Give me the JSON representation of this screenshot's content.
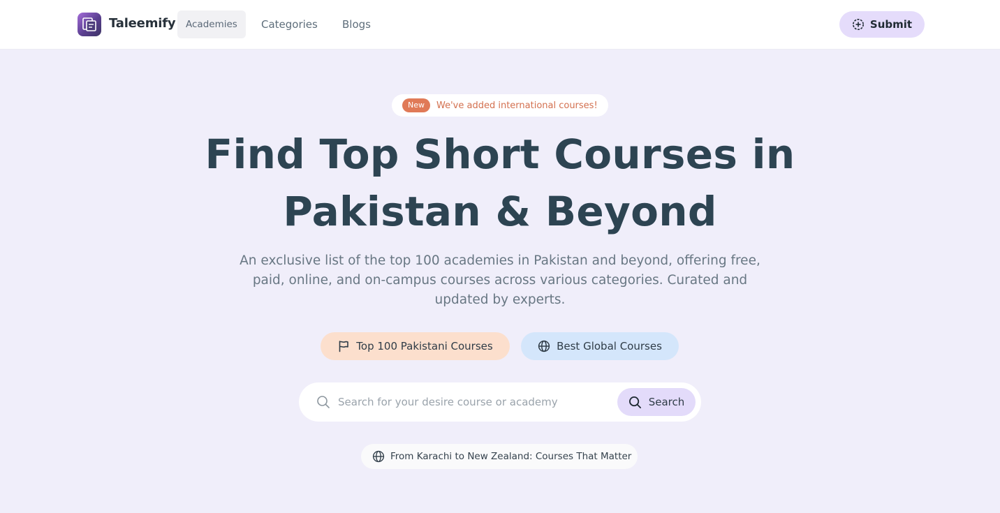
{
  "header": {
    "brand": "Taleemify",
    "nav": [
      {
        "label": "Academies",
        "active": true
      },
      {
        "label": "Categories",
        "active": false
      },
      {
        "label": "Blogs",
        "active": false
      }
    ],
    "submit_label": "Submit",
    "submit_icon": "plus-circle-icon"
  },
  "announcement": {
    "badge": "New",
    "text": "We've added international courses!"
  },
  "hero": {
    "title_line1": "Find Top Short Courses in",
    "title_line2": "Pakistan & Beyond",
    "subtitle_line1": "An exclusive list of the top 100 academies in Pakistan and beyond, offering free,",
    "subtitle_line2": "paid, online, and on-campus courses across various categories. Curated and",
    "subtitle_line3": "updated by experts."
  },
  "categories": [
    {
      "label": "Top 100 Pakistani Courses",
      "icon": "flag-icon"
    },
    {
      "label": "Best Global Courses",
      "icon": "globe-icon"
    }
  ],
  "search": {
    "placeholder": "Search for your desire course or academy",
    "value": "",
    "button_label": "Search"
  },
  "tagline": {
    "text": "From Karachi to New Zealand: Courses That Matter",
    "icon": "globe-icon"
  },
  "colors": {
    "page_bg": "#f0eefa",
    "header_bg": "#ffffff",
    "accent_purple": "#e5dcfb",
    "badge_orange": "#e07a57",
    "pk_button": "#fcdfcd",
    "global_button": "#d4e6fb",
    "heading": "#2d4452"
  }
}
